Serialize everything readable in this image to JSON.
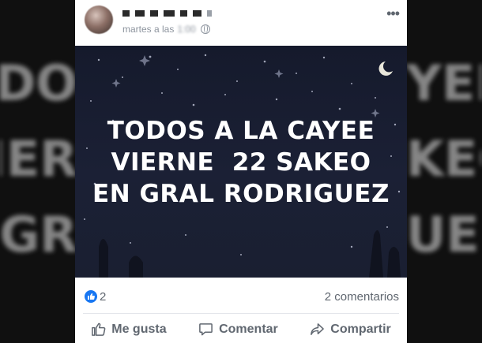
{
  "background_blur_left": [
    "ODO",
    "IER",
    "GR"
  ],
  "background_blur_right": [
    "YEE",
    "KEO",
    "UE"
  ],
  "post": {
    "timestamp": "martes a las",
    "timestamp_obscured": "1:00",
    "image_text": [
      "TODOS A LA CAYEE",
      "VIERNE  22 SAKEO",
      "EN GRAL RODRIGUEZ"
    ],
    "reaction_count": "2",
    "comment_count": "2 comentarios",
    "actions": {
      "like": "Me gusta",
      "comment": "Comentar",
      "share": "Compartir"
    }
  },
  "colors": {
    "accent": "#1877f2",
    "image_bg": "#1b2035",
    "muted_text": "#606770"
  },
  "icons": [
    "globe-icon",
    "more-icon",
    "like-icon",
    "thumbs-up-icon",
    "comment-icon",
    "share-icon",
    "moon-icon"
  ]
}
